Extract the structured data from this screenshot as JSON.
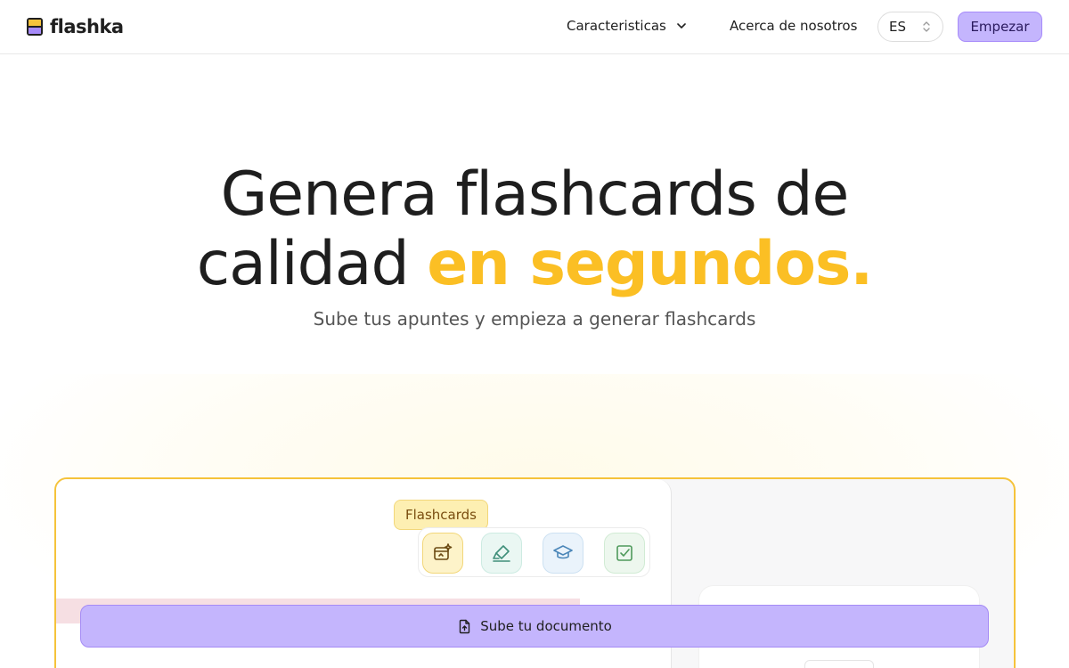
{
  "header": {
    "brand": "flashka",
    "nav": {
      "features": "Caracteristicas",
      "about": "Acerca de nosotros"
    },
    "language": "ES",
    "cta": "Empezar"
  },
  "hero": {
    "title_line1": "Genera flashcards de",
    "title_line2_plain": "calidad ",
    "title_line2_accent": "en segundos.",
    "subtitle": "Sube tus apuntes y empieza a generar flashcards"
  },
  "demo": {
    "tooltip": "Flashcards",
    "tools": [
      "sparkle-card-icon",
      "highlighter-icon",
      "graduation-cap-icon",
      "check-square-icon"
    ],
    "upload_label": "Sube tu documento"
  },
  "colors": {
    "accent_yellow": "#fbbf24",
    "accent_purple": "#c4b5fd"
  }
}
